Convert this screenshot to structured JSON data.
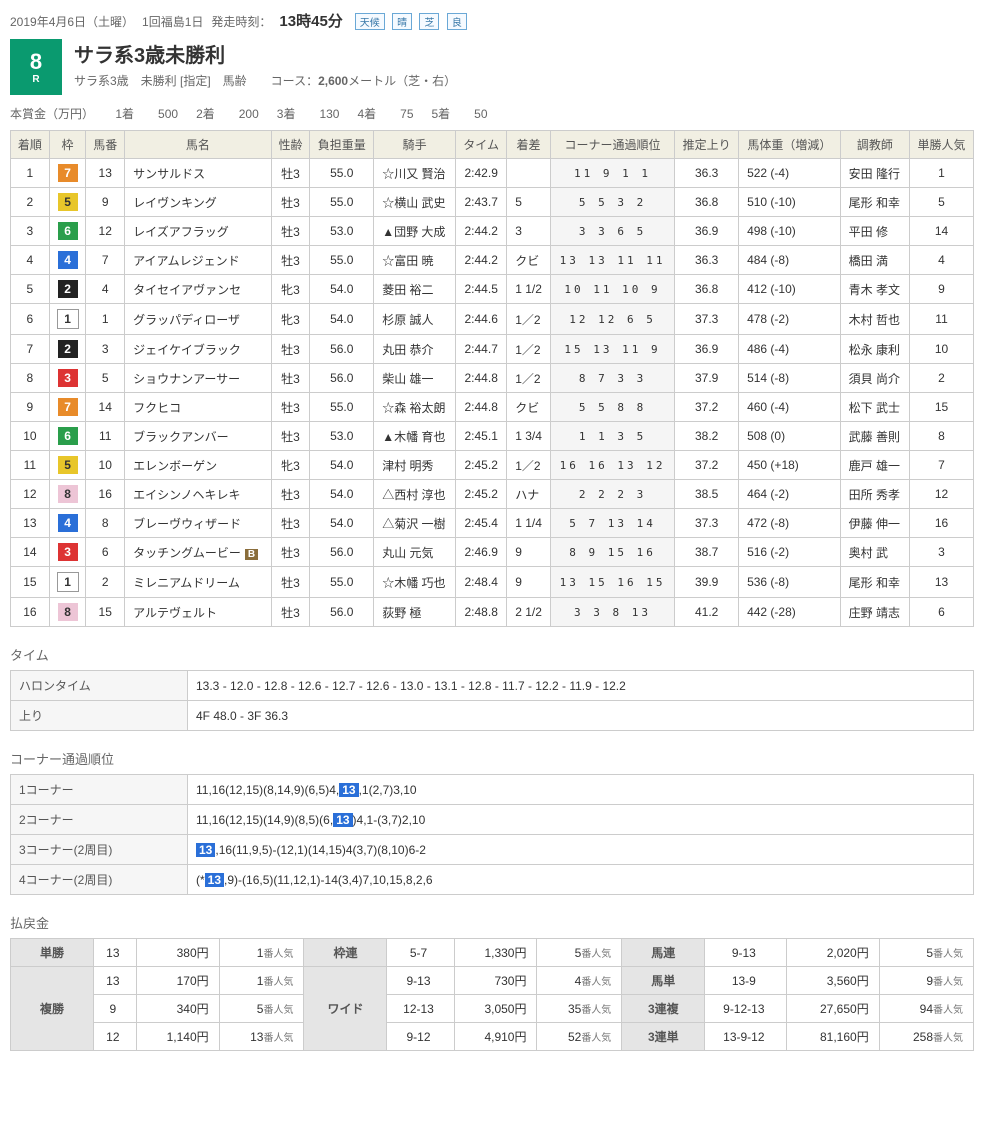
{
  "header": {
    "date": "2019年4月6日（土曜）",
    "meeting": "1回福島1日",
    "start_label": "発走時刻：",
    "start_time": "13時45分",
    "weather_label": "天候",
    "weather": "晴",
    "track_label": "芝",
    "track": "良"
  },
  "race": {
    "num": "8",
    "num_suffix": "R",
    "title": "サラ系3歳未勝利",
    "sub": "サラ系3歳　未勝利 [指定]　馬齢　　コース：",
    "distance": "2,600",
    "distance_suffix": "メートル（芝・右）"
  },
  "prize": {
    "label": "本賞金（万円）",
    "items": [
      [
        "1着",
        "500"
      ],
      [
        "2着",
        "200"
      ],
      [
        "3着",
        "130"
      ],
      [
        "4着",
        "75"
      ],
      [
        "5着",
        "50"
      ]
    ]
  },
  "columns": [
    "着順",
    "枠",
    "馬番",
    "馬名",
    "性齢",
    "負担重量",
    "騎手",
    "タイム",
    "着差",
    "コーナー通過順位",
    "推定上り",
    "馬体重（増減）",
    "調教師",
    "単勝人気"
  ],
  "rows": [
    {
      "rank": "1",
      "waku": "7",
      "num": "13",
      "name": "サンサルドス",
      "sex": "牡3",
      "wt": "55.0",
      "jockey": "☆川又 賢治",
      "time": "2:42.9",
      "margin": "",
      "corner": "11 9 1 1",
      "agari": "36.3",
      "bw": "522 (-4)",
      "trainer": "安田 隆行",
      "pop": "1"
    },
    {
      "rank": "2",
      "waku": "5",
      "num": "9",
      "name": "レイヴンキング",
      "sex": "牡3",
      "wt": "55.0",
      "jockey": "☆横山 武史",
      "time": "2:43.7",
      "margin": "5",
      "corner": "5 5 3 2",
      "agari": "36.8",
      "bw": "510 (-10)",
      "trainer": "尾形 和幸",
      "pop": "5"
    },
    {
      "rank": "3",
      "waku": "6",
      "num": "12",
      "name": "レイズアフラッグ",
      "sex": "牡3",
      "wt": "53.0",
      "jockey": "▲団野 大成",
      "time": "2:44.2",
      "margin": "3",
      "corner": "3 3 6 5",
      "agari": "36.9",
      "bw": "498 (-10)",
      "trainer": "平田 修",
      "pop": "14"
    },
    {
      "rank": "4",
      "waku": "4",
      "num": "7",
      "name": "アイアムレジェンド",
      "sex": "牡3",
      "wt": "55.0",
      "jockey": "☆富田 暁",
      "time": "2:44.2",
      "margin": "クビ",
      "corner": "13 13 11 11",
      "agari": "36.3",
      "bw": "484 (-8)",
      "trainer": "橋田 満",
      "pop": "4"
    },
    {
      "rank": "5",
      "waku": "2",
      "num": "4",
      "name": "タイセイアヴァンセ",
      "sex": "牝3",
      "wt": "54.0",
      "jockey": "菱田 裕二",
      "time": "2:44.5",
      "margin": "1 1/2",
      "corner": "10 11 10 9",
      "agari": "36.8",
      "bw": "412 (-10)",
      "trainer": "青木 孝文",
      "pop": "9"
    },
    {
      "rank": "6",
      "waku": "1",
      "num": "1",
      "name": "グラッパディローザ",
      "sex": "牝3",
      "wt": "54.0",
      "jockey": "杉原 誠人",
      "time": "2:44.6",
      "margin": "1／2",
      "corner": "12 12 6 5",
      "agari": "37.3",
      "bw": "478 (-2)",
      "trainer": "木村 哲也",
      "pop": "11"
    },
    {
      "rank": "7",
      "waku": "2",
      "num": "3",
      "name": "ジェイケイブラック",
      "sex": "牡3",
      "wt": "56.0",
      "jockey": "丸田 恭介",
      "time": "2:44.7",
      "margin": "1／2",
      "corner": "15 13 11 9",
      "agari": "36.9",
      "bw": "486 (-4)",
      "trainer": "松永 康利",
      "pop": "10"
    },
    {
      "rank": "8",
      "waku": "3",
      "num": "5",
      "name": "ショウナンアーサー",
      "sex": "牡3",
      "wt": "56.0",
      "jockey": "柴山 雄一",
      "time": "2:44.8",
      "margin": "1／2",
      "corner": "8 7 3 3",
      "agari": "37.9",
      "bw": "514 (-8)",
      "trainer": "須貝 尚介",
      "pop": "2"
    },
    {
      "rank": "9",
      "waku": "7",
      "num": "14",
      "name": "フクヒコ",
      "sex": "牡3",
      "wt": "55.0",
      "jockey": "☆森 裕太朗",
      "time": "2:44.8",
      "margin": "クビ",
      "corner": "5 5 8 8",
      "agari": "37.2",
      "bw": "460 (-4)",
      "trainer": "松下 武士",
      "pop": "15"
    },
    {
      "rank": "10",
      "waku": "6",
      "num": "11",
      "name": "ブラックアンバー",
      "sex": "牡3",
      "wt": "53.0",
      "jockey": "▲木幡 育也",
      "time": "2:45.1",
      "margin": "1 3/4",
      "corner": "1 1 3 5",
      "agari": "38.2",
      "bw": "508 (0)",
      "trainer": "武藤 善則",
      "pop": "8"
    },
    {
      "rank": "11",
      "waku": "5",
      "num": "10",
      "name": "エレンボーゲン",
      "sex": "牝3",
      "wt": "54.0",
      "jockey": "津村 明秀",
      "time": "2:45.2",
      "margin": "1／2",
      "corner": "16 16 13 12",
      "agari": "37.2",
      "bw": "450 (+18)",
      "trainer": "鹿戸 雄一",
      "pop": "7"
    },
    {
      "rank": "12",
      "waku": "8",
      "num": "16",
      "name": "エイシンノヘキレキ",
      "sex": "牡3",
      "wt": "54.0",
      "jockey": "△西村 淳也",
      "time": "2:45.2",
      "margin": "ハナ",
      "corner": "2 2 2 3",
      "agari": "38.5",
      "bw": "464 (-2)",
      "trainer": "田所 秀孝",
      "pop": "12"
    },
    {
      "rank": "13",
      "waku": "4",
      "num": "8",
      "name": "ブレーヴウィザード",
      "sex": "牡3",
      "wt": "54.0",
      "jockey": "△菊沢 一樹",
      "time": "2:45.4",
      "margin": "1 1/4",
      "corner": "5 7 13 14",
      "agari": "37.3",
      "bw": "472 (-8)",
      "trainer": "伊藤 伸一",
      "pop": "16"
    },
    {
      "rank": "14",
      "waku": "3",
      "num": "6",
      "name": "タッチングムービー",
      "badge": "B",
      "sex": "牡3",
      "wt": "56.0",
      "jockey": "丸山 元気",
      "time": "2:46.9",
      "margin": "9",
      "corner": "8 9 15 16",
      "agari": "38.7",
      "bw": "516 (-2)",
      "trainer": "奥村 武",
      "pop": "3"
    },
    {
      "rank": "15",
      "waku": "1",
      "num": "2",
      "name": "ミレニアムドリーム",
      "sex": "牡3",
      "wt": "55.0",
      "jockey": "☆木幡 巧也",
      "time": "2:48.4",
      "margin": "9",
      "corner": "13 15 16 15",
      "agari": "39.9",
      "bw": "536 (-8)",
      "trainer": "尾形 和幸",
      "pop": "13"
    },
    {
      "rank": "16",
      "waku": "8",
      "num": "15",
      "name": "アルテヴェルト",
      "sex": "牡3",
      "wt": "56.0",
      "jockey": "荻野 極",
      "time": "2:48.8",
      "margin": "2 1/2",
      "corner": "3 3 8 13",
      "agari": "41.2",
      "bw": "442 (-28)",
      "trainer": "庄野 靖志",
      "pop": "6"
    }
  ],
  "time_section": {
    "title": "タイム",
    "rows": [
      [
        "ハロンタイム",
        "13.3 - 12.0 - 12.8 - 12.6 - 12.7 - 12.6 - 13.0 - 13.1 - 12.8 - 11.7 - 12.2 - 11.9 - 12.2"
      ],
      [
        "上り",
        "4F 48.0 - 3F 36.3"
      ]
    ]
  },
  "corner_section": {
    "title": "コーナー通過順位",
    "rows": [
      {
        "label": "1コーナー",
        "before": "11,16(12,15)(8,14,9)(6,5)4,",
        "hl": "13",
        "after": ",1(2,7)3,10"
      },
      {
        "label": "2コーナー",
        "before": "11,16(12,15)(14,9)(8,5)(6,",
        "hl": "13",
        "after": ")4,1-(3,7)2,10"
      },
      {
        "label": "3コーナー(2周目)",
        "before": "",
        "hl": "13",
        "after": ",16(11,9,5)-(12,1)(14,15)4(3,7)(8,10)6-2"
      },
      {
        "label": "4コーナー(2周目)",
        "before": "(*",
        "hl": "13",
        "after": ",9)-(16,5)(11,12,1)-14(3,4)7,10,15,8,2,6"
      }
    ]
  },
  "payout": {
    "title": "払戻金",
    "tansho": {
      "label": "単勝",
      "rows": [
        [
          "13",
          "380",
          "1"
        ]
      ]
    },
    "fukusho": {
      "label": "複勝",
      "rows": [
        [
          "13",
          "170",
          "1"
        ],
        [
          "9",
          "340",
          "5"
        ],
        [
          "12",
          "1,140",
          "13"
        ]
      ]
    },
    "wakuren": {
      "label": "枠連",
      "rows": [
        [
          "5-7",
          "1,330",
          "5"
        ]
      ]
    },
    "wide": {
      "label": "ワイド",
      "rows": [
        [
          "9-13",
          "730",
          "4"
        ],
        [
          "12-13",
          "3,050",
          "35"
        ],
        [
          "9-12",
          "4,910",
          "52"
        ]
      ]
    },
    "umaren": {
      "label": "馬連",
      "rows": [
        [
          "9-13",
          "2,020",
          "5"
        ]
      ]
    },
    "umatan": {
      "label": "馬単",
      "rows": [
        [
          "13-9",
          "3,560",
          "9"
        ]
      ]
    },
    "sanpuku": {
      "label": "3連複",
      "rows": [
        [
          "9-12-13",
          "27,650",
          "94"
        ]
      ]
    },
    "santan": {
      "label": "3連単",
      "rows": [
        [
          "13-9-12",
          "81,160",
          "258"
        ]
      ]
    },
    "yen": "円",
    "ninki": "番人気"
  }
}
